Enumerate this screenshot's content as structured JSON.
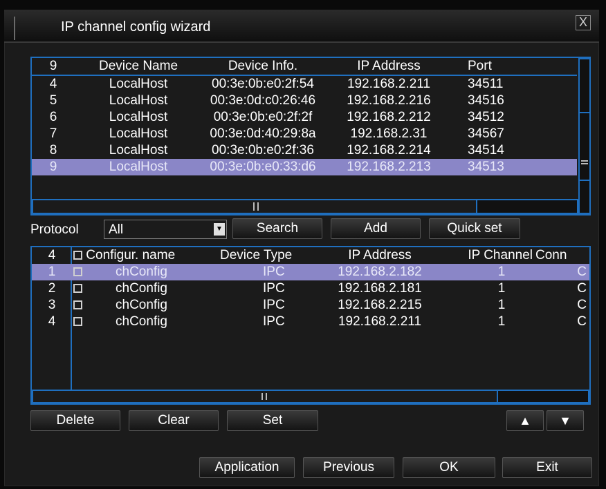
{
  "window": {
    "title": "IP channel config wizard",
    "close_label": "X"
  },
  "device_table": {
    "columns": [
      "9",
      "Device Name",
      "Device Info.",
      "IP Address",
      "Port"
    ],
    "rows": [
      {
        "no": "4",
        "name": "LocalHost",
        "info": "00:3e:0b:e0:2f:54",
        "ip": "192.168.2.211",
        "port": "34511"
      },
      {
        "no": "5",
        "name": "LocalHost",
        "info": "00:3e:0d:c0:26:46",
        "ip": "192.168.2.216",
        "port": "34516"
      },
      {
        "no": "6",
        "name": "LocalHost",
        "info": "00:3e:0b:e0:2f:2f",
        "ip": "192.168.2.212",
        "port": "34512"
      },
      {
        "no": "7",
        "name": "LocalHost",
        "info": "00:3e:0d:40:29:8a",
        "ip": "192.168.2.31",
        "port": "34567"
      },
      {
        "no": "8",
        "name": "LocalHost",
        "info": "00:3e:0b:e0:2f:36",
        "ip": "192.168.2.214",
        "port": "34514"
      },
      {
        "no": "9",
        "name": "LocalHost",
        "info": "00:3e:0b:e0:33:d6",
        "ip": "192.168.2.213",
        "port": "34513",
        "selected": true
      }
    ]
  },
  "search_bar": {
    "protocol_label": "Protocol",
    "protocol_value": "All",
    "search_label": "Search",
    "add_label": "Add",
    "quick_set_label": "Quick set"
  },
  "config_table": {
    "columns": [
      "4",
      "Configur. name",
      "Device Type",
      "IP Address",
      "IP Channel",
      "Conn"
    ],
    "rows": [
      {
        "no": "1",
        "name": "chConfig",
        "type": "IPC",
        "ip": "192.168.2.182",
        "channel": "1",
        "conn": "C",
        "selected": true
      },
      {
        "no": "2",
        "name": "chConfig",
        "type": "IPC",
        "ip": "192.168.2.181",
        "channel": "1",
        "conn": "C"
      },
      {
        "no": "3",
        "name": "chConfig",
        "type": "IPC",
        "ip": "192.168.2.215",
        "channel": "1",
        "conn": "C"
      },
      {
        "no": "4",
        "name": "chConfig",
        "type": "IPC",
        "ip": "192.168.2.211",
        "channel": "1",
        "conn": "C"
      }
    ]
  },
  "row_actions": {
    "delete": "Delete",
    "clear": "Clear",
    "set": "Set",
    "up": "▲",
    "down": "▼"
  },
  "footer": {
    "application": "Application",
    "previous": "Previous",
    "ok": "OK",
    "exit": "Exit"
  },
  "colors": {
    "accent": "#1f6fbf",
    "selection": "#8a86c7",
    "background": "#1b1b1b"
  }
}
